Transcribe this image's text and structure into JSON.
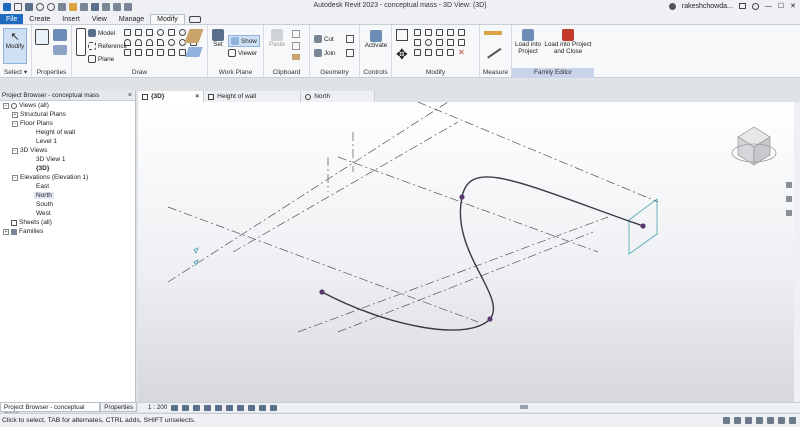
{
  "titlebar": {
    "title": "Autodesk Revit 2023 - conceptual mass - 3D View: {3D}",
    "user": "rakeshchowda...",
    "colors": {
      "accent": "#1e6bbf"
    }
  },
  "menu": {
    "tabs": [
      "File",
      "Create",
      "Insert",
      "View",
      "Manage",
      "Modify"
    ],
    "active": "Modify"
  },
  "ribbon": {
    "select": {
      "button": "Modify",
      "label": "Select",
      "dropdown": "▾"
    },
    "properties": {
      "label": "Properties"
    },
    "draw": {
      "label": "Draw",
      "model": "Model",
      "reference": "Reference",
      "plane": "Plane"
    },
    "work_plane": {
      "label": "Work Plane",
      "set": "Set",
      "show": "Show",
      "viewer": "Viewer"
    },
    "clipboard": {
      "label": "Clipboard",
      "paste": "Paste"
    },
    "geometry": {
      "label": "Geometry",
      "cut": "Cut",
      "join": "Join"
    },
    "controls": {
      "label": "Controls",
      "activate": "Activate"
    },
    "modify": {
      "label": "Modify"
    },
    "measure": {
      "label": "Measure"
    },
    "family_editor": {
      "label": "Family Editor",
      "load_into_project": "Load into Project",
      "load_into_project_close": "Load into Project and Close"
    }
  },
  "browser": {
    "title": "Project Browser - conceptual mass",
    "close": "×",
    "items": [
      {
        "label": "Views (all)",
        "level": 0,
        "toggle": "−"
      },
      {
        "label": "Structural Plans",
        "level": 1,
        "toggle": "+"
      },
      {
        "label": "Floor Plans",
        "level": 1,
        "toggle": "−"
      },
      {
        "label": "Height of wall",
        "level": 2,
        "toggle": ""
      },
      {
        "label": "Level 1",
        "level": 2,
        "toggle": ""
      },
      {
        "label": "3D Views",
        "level": 1,
        "toggle": "−"
      },
      {
        "label": "3D View 1",
        "level": 2,
        "toggle": ""
      },
      {
        "label": "{3D}",
        "level": 2,
        "toggle": "",
        "bold": true
      },
      {
        "label": "Elevations (Elevation 1)",
        "level": 1,
        "toggle": "−"
      },
      {
        "label": "East",
        "level": 2,
        "toggle": ""
      },
      {
        "label": "North",
        "level": 2,
        "toggle": "",
        "selected": true
      },
      {
        "label": "South",
        "level": 2,
        "toggle": ""
      },
      {
        "label": "West",
        "level": 2,
        "toggle": ""
      },
      {
        "label": "Sheets (all)",
        "level": 0,
        "toggle": ""
      },
      {
        "label": "Families",
        "level": 0,
        "toggle": "+"
      }
    ],
    "footer_tabs": [
      "Project Browser - conceptual mass",
      "Properties"
    ]
  },
  "view_tabs": [
    {
      "label": "{3D}",
      "close": "×",
      "active": true
    },
    {
      "label": "Height of wall",
      "close": "",
      "active": false
    },
    {
      "label": "North",
      "close": "",
      "active": false
    }
  ],
  "view_control": {
    "scale": "1 : 200"
  },
  "status": {
    "text": "Click to select, TAB for alternates, CTRL adds, SHIFT unselects."
  }
}
